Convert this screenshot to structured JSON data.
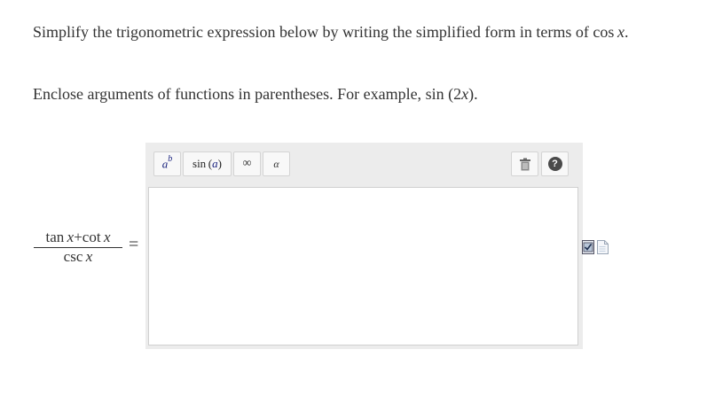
{
  "question": {
    "instruction_line1": {
      "before": "Simplify the trigonometric expression below by writing the simplified form in terms of ",
      "fn": "cos",
      "var": "x",
      "after": "."
    },
    "instruction_line2": {
      "before": "Enclose arguments of functions in parentheses. For example, ",
      "example_fn": "sin",
      "example_open": " (2",
      "example_var": "x",
      "example_close": ")",
      "after": "."
    },
    "expression": {
      "numerator_fn1": "tan",
      "numerator_var1": "x",
      "plus": "+",
      "numerator_fn2": "cot",
      "numerator_var2": "x",
      "denominator_fn": "csc",
      "denominator_var": "x",
      "equals": "="
    }
  },
  "toolbar": {
    "power_base": "a",
    "power_exp": "b",
    "sin_label": "sin",
    "sin_arg": "a",
    "infinity": "∞",
    "alpha": "α",
    "help": "?"
  },
  "answer": {
    "value": ""
  },
  "icons": {
    "power": "power-template-icon",
    "trash": "trash-icon",
    "help": "help-icon",
    "check": "check-document-icon",
    "doc": "document-icon"
  }
}
